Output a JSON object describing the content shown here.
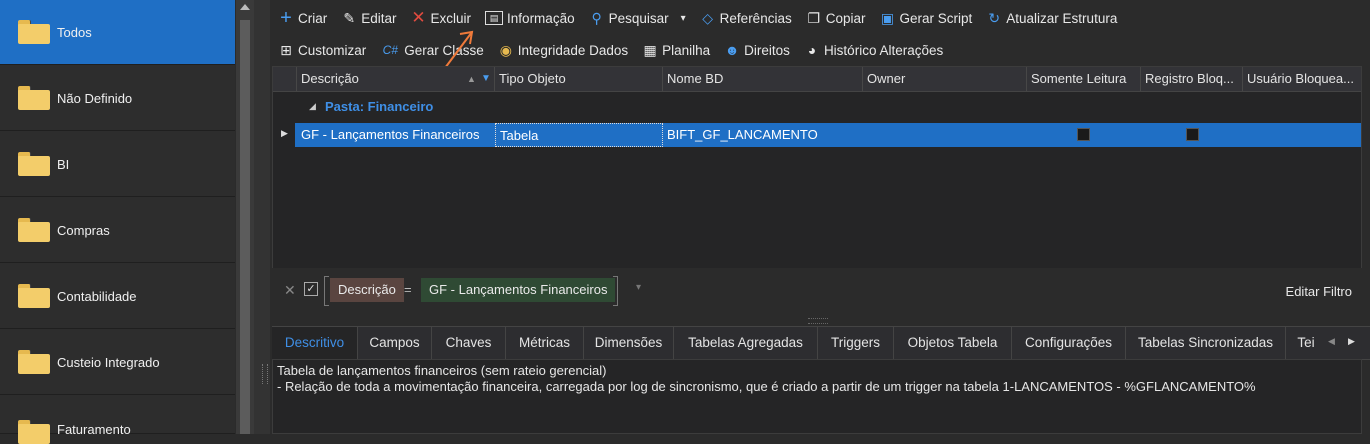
{
  "sidebar": {
    "items": [
      {
        "label": "Todos"
      },
      {
        "label": "Não Definido"
      },
      {
        "label": "BI"
      },
      {
        "label": "Compras"
      },
      {
        "label": "Contabilidade"
      },
      {
        "label": "Custeio Integrado"
      },
      {
        "label": "Faturamento"
      }
    ]
  },
  "toolbar": {
    "row1": [
      {
        "label": "Criar",
        "icon": "plus-icon"
      },
      {
        "label": "Editar",
        "icon": "edit-icon"
      },
      {
        "label": "Excluir",
        "icon": "delete-x-icon"
      },
      {
        "label": "Informação",
        "icon": "info-card-icon"
      },
      {
        "label": "Pesquisar",
        "icon": "search-icon"
      },
      {
        "label": "Referências",
        "icon": "tag-icon"
      },
      {
        "label": "Copiar",
        "icon": "copy-icon"
      },
      {
        "label": "Gerar Script",
        "icon": "script-icon"
      },
      {
        "label": "Atualizar Estrutura",
        "icon": "refresh-icon"
      }
    ],
    "row2": [
      {
        "label": "Customizar",
        "icon": "customize-icon"
      },
      {
        "label": "Gerar Classe",
        "icon": "csharp-icon"
      },
      {
        "label": "Integridade Dados",
        "icon": "database-icon"
      },
      {
        "label": "Planilha",
        "icon": "spreadsheet-icon"
      },
      {
        "label": "Direitos",
        "icon": "users-icon"
      },
      {
        "label": "Histórico Alterações",
        "icon": "history-icon"
      }
    ]
  },
  "grid": {
    "columns": [
      "Descrição",
      "Tipo Objeto",
      "Nome BD",
      "Owner",
      "Somente Leitura",
      "Registro Bloq...",
      "Usuário Bloquea..."
    ],
    "group": "Pasta: Financeiro",
    "rows": [
      {
        "descricao": "GF - Lançamentos Financeiros",
        "tipo": "Tabela",
        "nome_bd": "BIFT_GF_LANCAMENTO",
        "owner": "",
        "somente_leitura": false,
        "registro_bloq": false,
        "usuario": ""
      }
    ]
  },
  "filter": {
    "field": "Descrição",
    "operator": "=",
    "value": "GF - Lançamentos Financeiros",
    "edit_label": "Editar Filtro"
  },
  "tabs": [
    "Descritivo",
    "Campos",
    "Chaves",
    "Métricas",
    "Dimensões",
    "Tabelas Agregadas",
    "Triggers",
    "Objetos Tabela",
    "Configurações",
    "Tabelas Sincronizadas",
    "Tei"
  ],
  "memo": {
    "line1": "Tabela de lançamentos financeiros (sem rateio gerencial)",
    "line2": "- Relação de toda a movimentação financeira, carregada por log de sincronismo, que é criado a partir de um trigger na tabela 1-LANCAMENTOS - %GFLANCAMENTO%"
  },
  "colors": {
    "accent": "#1f6fc5",
    "group_text": "#3f8fe6",
    "arrow": "#f07a3a"
  }
}
